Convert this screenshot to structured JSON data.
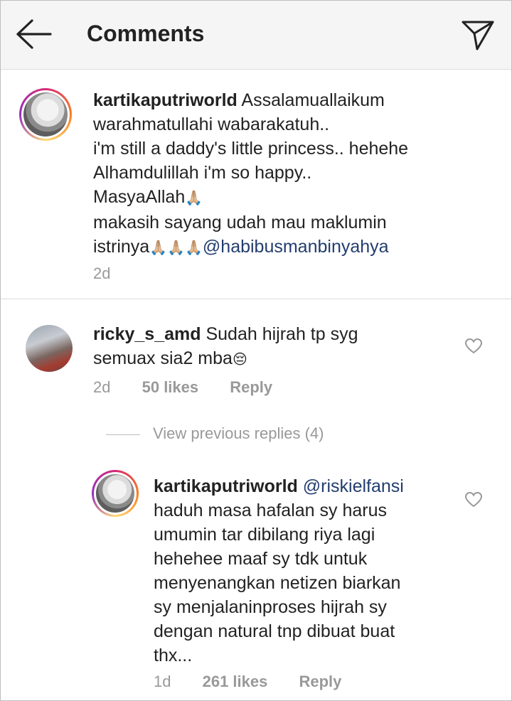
{
  "header": {
    "title": "Comments",
    "back_icon": "arrow-left-icon",
    "direct_icon": "paper-plane-icon"
  },
  "caption": {
    "username": "kartikaputriworld",
    "lines": [
      "Assalamuallaikum",
      "warahmatullahi wabarakatuh..",
      "i'm still a daddy's little princess.. hehehe",
      "Alhamdulillah i'm so happy..",
      "MasyaAllah",
      "makasih sayang udah mau maklumin",
      "istrinya"
    ],
    "emoji_pray": "🙏🏼",
    "mention": "@habibusmanbinyahya",
    "time": "2d"
  },
  "comment": {
    "username": "ricky_s_amd",
    "text_line1": "Sudah hijrah tp syg",
    "text_line2": "semuax sia2 mba",
    "emoji": "😔",
    "time": "2d",
    "likes": "50 likes",
    "reply": "Reply"
  },
  "view_previous": "View previous replies (4)",
  "reply": {
    "username": "kartikaputriworld",
    "mention": "@riskielfansi",
    "lines": [
      "haduh masa hafalan sy harus",
      "umumin tar dibilang riya lagi",
      "hehehee maaf sy tdk untuk",
      "menyenangkan netizen biarkan",
      "sy menjalaninproses hijrah sy",
      "dengan natural tnp dibuat buat",
      "thx..."
    ],
    "time": "1d",
    "likes": "261 likes",
    "reply": "Reply"
  },
  "colors": {
    "mention": "#233d6e",
    "meta": "#999999",
    "header_bg": "#f5f5f5"
  }
}
